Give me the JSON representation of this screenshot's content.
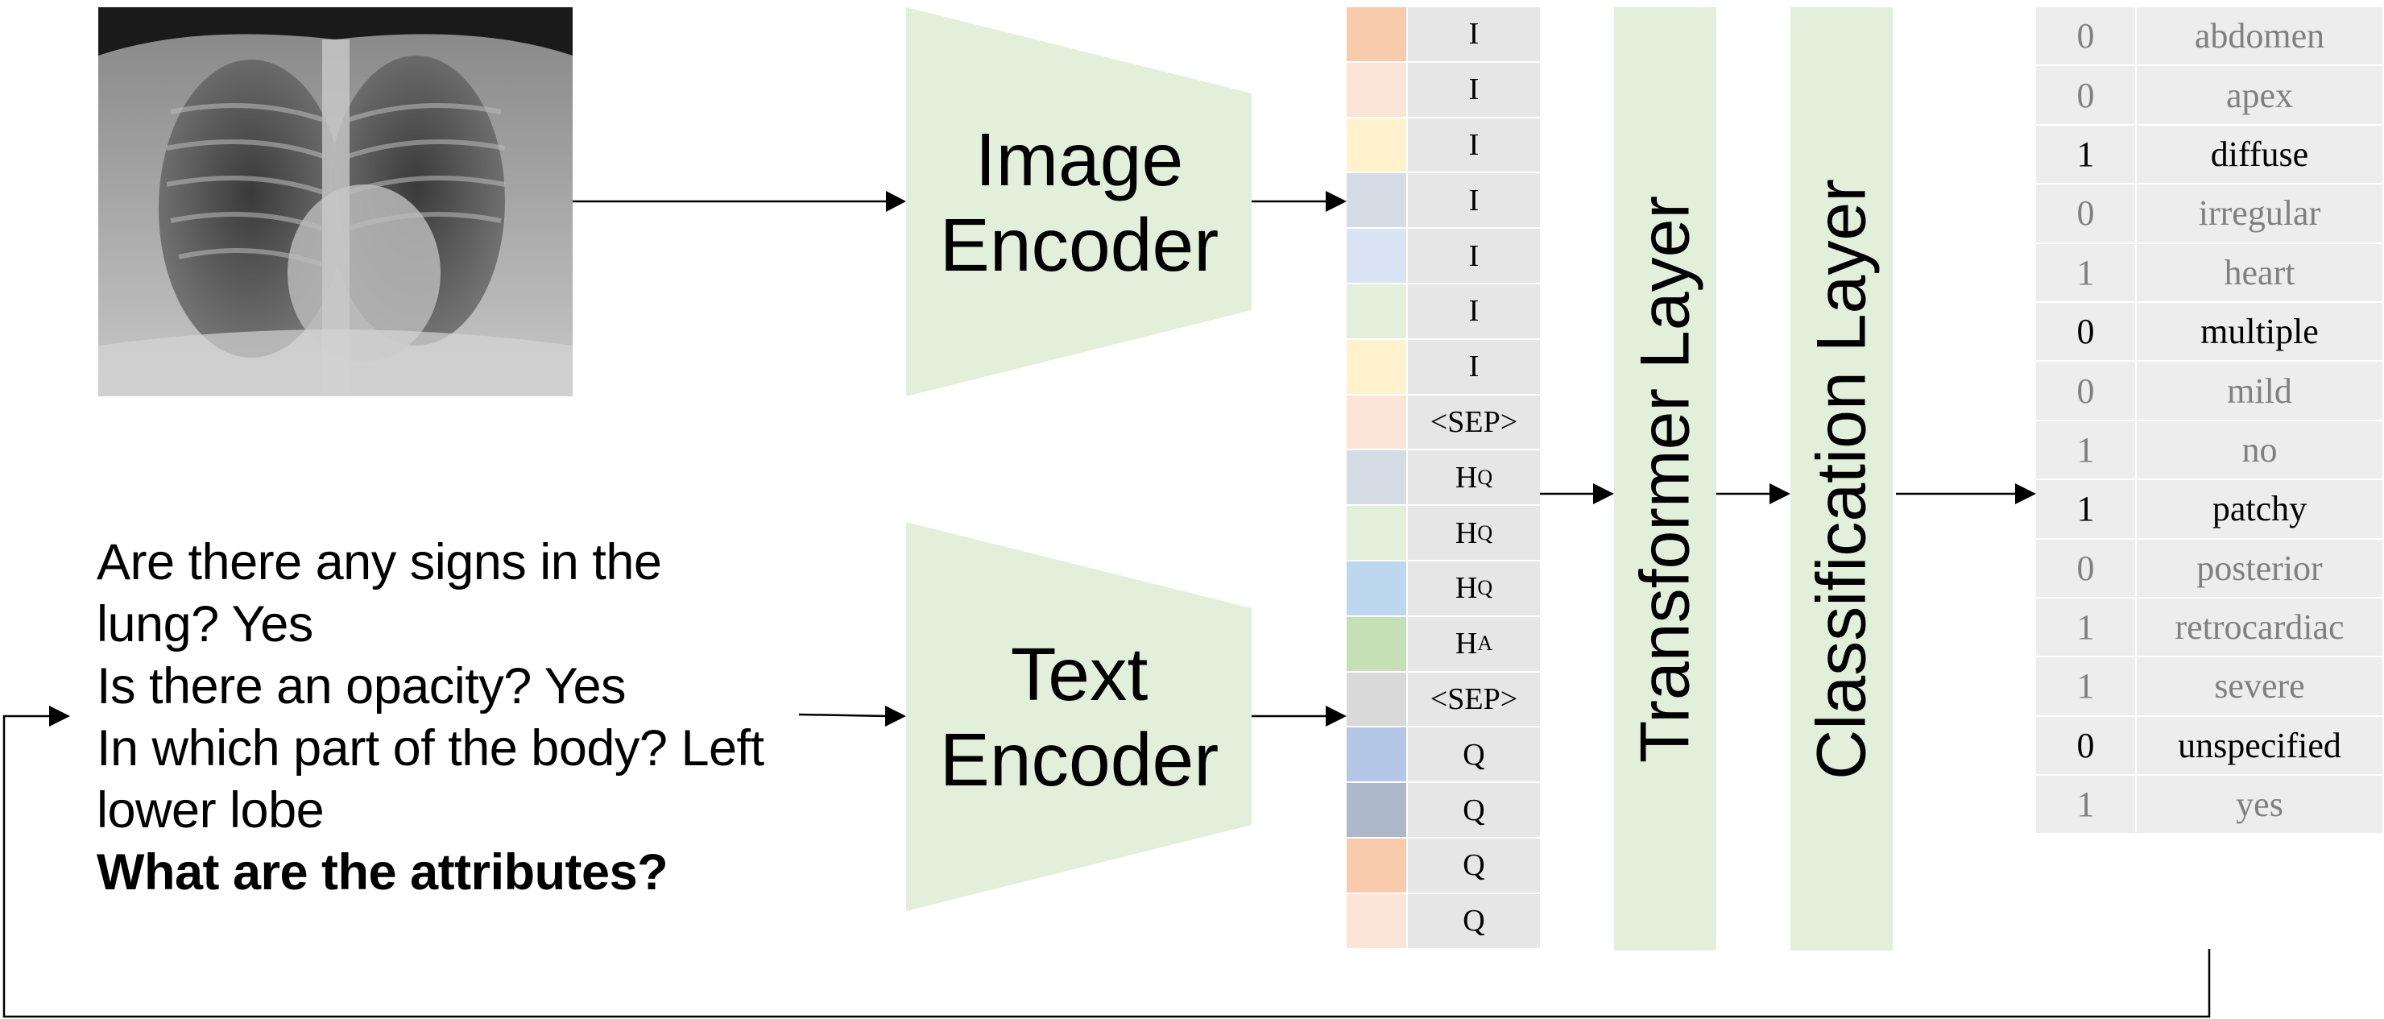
{
  "figure": {
    "input_image": {
      "description": "chest x-ray",
      "icon": "xray-image"
    },
    "dialogue": {
      "lines": [
        {
          "text": "Are there any signs in the",
          "bold": false
        },
        {
          "text": "lung? Yes",
          "bold": false
        },
        {
          "text": "Is there an opacity? Yes",
          "bold": false
        },
        {
          "text": "In which part of the body? Left",
          "bold": false
        },
        {
          "text": "lower lobe",
          "bold": false
        },
        {
          "text": "What are the attributes?",
          "bold": true
        }
      ]
    },
    "image_encoder": {
      "line1": "Image",
      "line2": "Encoder"
    },
    "text_encoder": {
      "line1": "Text",
      "line2": "Encoder"
    },
    "tokens": [
      {
        "label": "I",
        "sub": "",
        "color": "#f8cbad"
      },
      {
        "label": "I",
        "sub": "",
        "color": "#fbe5d6"
      },
      {
        "label": "I",
        "sub": "",
        "color": "#fff2cc"
      },
      {
        "label": "I",
        "sub": "",
        "color": "#d6dce5"
      },
      {
        "label": "I",
        "sub": "",
        "color": "#dae3f3"
      },
      {
        "label": "I",
        "sub": "",
        "color": "#e2efda"
      },
      {
        "label": "I",
        "sub": "",
        "color": "#fff2cc"
      },
      {
        "label": "<SEP>",
        "sub": "",
        "color": "#fbe5d6"
      },
      {
        "label": "H",
        "sub": "Q",
        "color": "#d6dce5"
      },
      {
        "label": "H",
        "sub": "Q",
        "color": "#e2efda"
      },
      {
        "label": "H",
        "sub": "Q",
        "color": "#bdd7ee"
      },
      {
        "label": "H",
        "sub": "A",
        "color": "#c5e0b4"
      },
      {
        "label": "<SEP>",
        "sub": "",
        "color": "#d9d9d9"
      },
      {
        "label": "Q",
        "sub": "",
        "color": "#b4c7e7"
      },
      {
        "label": "Q",
        "sub": "",
        "color": "#adb9ca"
      },
      {
        "label": "Q",
        "sub": "",
        "color": "#f8cbad"
      },
      {
        "label": "Q",
        "sub": "",
        "color": "#fbe5d6"
      }
    ],
    "transformer_layer": {
      "label": "Transformer Layer"
    },
    "classification_layer": {
      "label": "Classification Layer"
    },
    "outputs": [
      {
        "value": "0",
        "name": "abdomen",
        "highlight": false
      },
      {
        "value": "0",
        "name": "apex",
        "highlight": false
      },
      {
        "value": "1",
        "name": "diffuse",
        "highlight": true
      },
      {
        "value": "0",
        "name": "irregular",
        "highlight": false
      },
      {
        "value": "1",
        "name": "heart",
        "highlight": false
      },
      {
        "value": "0",
        "name": "multiple",
        "highlight": true
      },
      {
        "value": "0",
        "name": "mild",
        "highlight": false
      },
      {
        "value": "1",
        "name": "no",
        "highlight": false
      },
      {
        "value": "1",
        "name": "patchy",
        "highlight": true
      },
      {
        "value": "0",
        "name": "posterior",
        "highlight": false
      },
      {
        "value": "1",
        "name": "retrocardiac",
        "highlight": false
      },
      {
        "value": "1",
        "name": "severe",
        "highlight": false
      },
      {
        "value": "0",
        "name": "unspecified",
        "highlight": true
      },
      {
        "value": "1",
        "name": "yes",
        "highlight": false
      }
    ],
    "colors": {
      "block_fill": "#e2efda",
      "token_label_bg": "#e6e6e6",
      "output_bg": "#ededed",
      "output_muted_text": "#808080",
      "output_strong_text": "#000000",
      "arrow": "#000000"
    }
  }
}
